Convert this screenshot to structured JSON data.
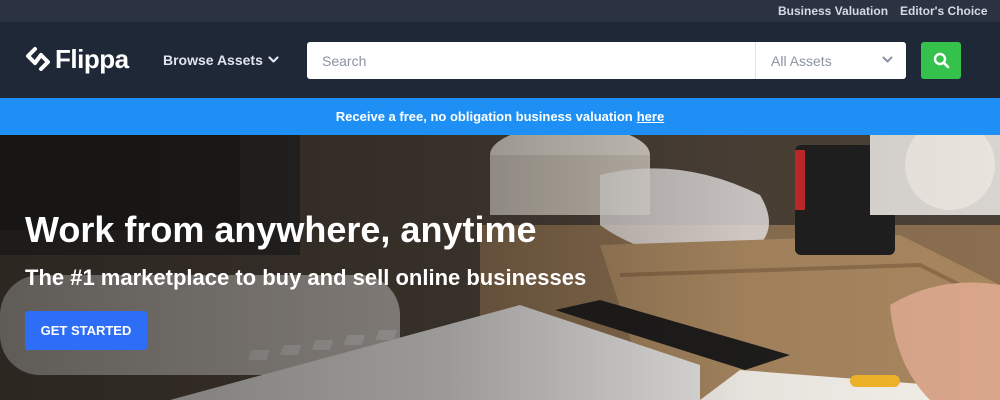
{
  "topbar": {
    "links": [
      {
        "label": "Business Valuation"
      },
      {
        "label": "Editor's Choice"
      }
    ]
  },
  "nav": {
    "logo_text": "Flippa",
    "browse_label": "Browse Assets",
    "search": {
      "placeholder": "Search",
      "value": ""
    },
    "category": {
      "selected": "All Assets"
    },
    "icons": {
      "logo": "flippa-logo-icon",
      "browse_chevron": "chevron-down-icon",
      "category_chevron": "chevron-down-icon",
      "search": "search-icon"
    }
  },
  "promo": {
    "text": "Receive a free, no obligation business valuation",
    "link_label": "here"
  },
  "hero": {
    "title": "Work from anywhere, anytime",
    "subtitle": "The #1 marketplace to buy and sell online businesses",
    "cta_label": "GET STARTED"
  },
  "colors": {
    "topbar_bg": "#2b3342",
    "nav_bg": "#1f2837",
    "promo_bg": "#1e90f5",
    "search_button": "#34c24d",
    "cta_button": "#2e6ef6"
  }
}
